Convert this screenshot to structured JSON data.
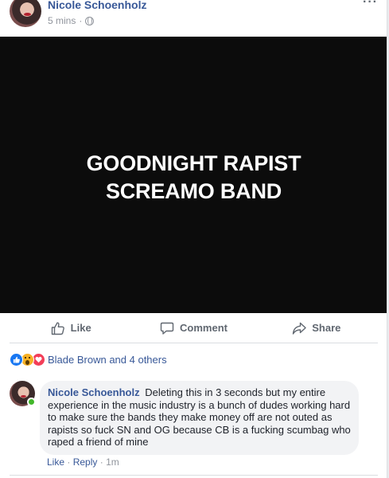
{
  "post": {
    "author": "Nicole Schoenholz",
    "time": "5 mins",
    "separator": "·",
    "more_label": "···",
    "image_text": "GOODNIGHT RAPIST\nSCREAMO BAND"
  },
  "actions": {
    "like_label": "Like",
    "comment_label": "Comment",
    "share_label": "Share"
  },
  "reactions": {
    "icons": [
      "like-icon",
      "wow-icon",
      "love-icon"
    ],
    "summary": "Blade Brown and 4 others"
  },
  "comment": {
    "author": "Nicole Schoenholz",
    "text": "Deleting this in 3 seconds but my entire experience in the music industry is a bunch of dudes working hard to make sure the bands they make money off are not outed as rapists so fuck SN and OG because CB is a fucking scumbag who raped a friend of mine",
    "like_label": "Like",
    "reply_label": "Reply",
    "dot": "·",
    "time": "1m"
  },
  "colors": {
    "link_blue": "#385898",
    "meta_gray": "#90949c",
    "like_blue": "#1877f2",
    "online_green": "#42b72a"
  }
}
